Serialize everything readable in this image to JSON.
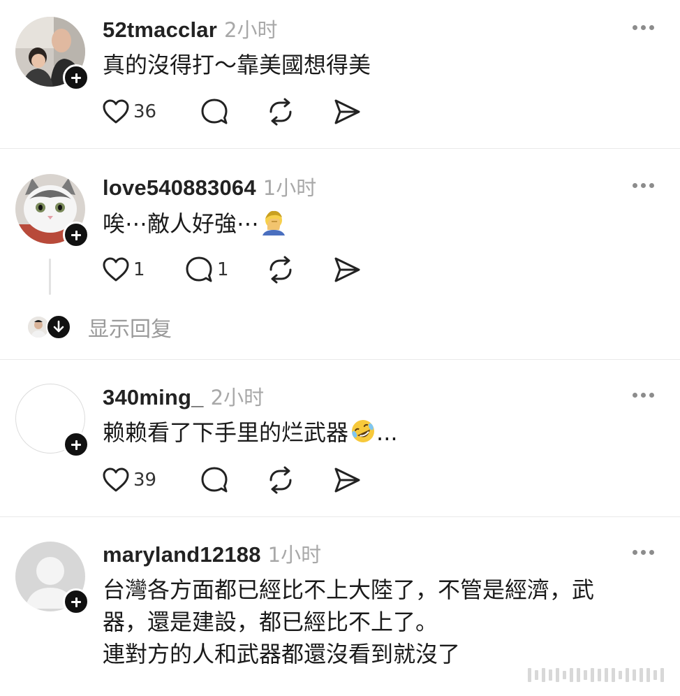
{
  "posts": [
    {
      "username": "52tmacclar",
      "time": "2小时",
      "text_lines": [
        "真的沒得打～靠美國想得美"
      ],
      "likes": "36",
      "replies": "",
      "avatar": "photo-man-and-child"
    },
    {
      "username": "love540883064",
      "time": "1小时",
      "text_lines": [
        "唉⋯敵人好強⋯"
      ],
      "trailing_emoji": "face-palm-emoji",
      "likes": "1",
      "replies": "1",
      "avatar": "photo-cat",
      "show_replies_label": "显示回复"
    },
    {
      "username": "340ming_",
      "time": "2小时",
      "text_lines": [
        "赖赖看了下手里的烂武器"
      ],
      "trailing_emoji": "rolling-on-floor-laughing-emoji",
      "trailing_text": "...",
      "likes": "39",
      "replies": "",
      "avatar": "blank-avatar"
    },
    {
      "username": "maryland12188",
      "time": "1小时",
      "text_lines": [
        "台灣各方面都已經比不上大陸了，不管是經濟，武",
        "器，還是建設，都已經比不上了。",
        "連對方的人和武器都還沒看到就沒了"
      ],
      "likes": "",
      "replies": "",
      "avatar": "default-person-avatar"
    }
  ],
  "icons": {
    "like": "heart-icon",
    "reply": "comment-bubble-icon",
    "repost": "repost-icon",
    "share": "send-icon",
    "more": "more-dots-icon",
    "follow": "plus-icon",
    "expand": "arrow-down-icon"
  },
  "colors": {
    "text": "#1a1a1a",
    "muted": "#a8a8a8",
    "divider": "#e9e9e9",
    "icon": "#222222",
    "follow_badge": "#111111"
  }
}
